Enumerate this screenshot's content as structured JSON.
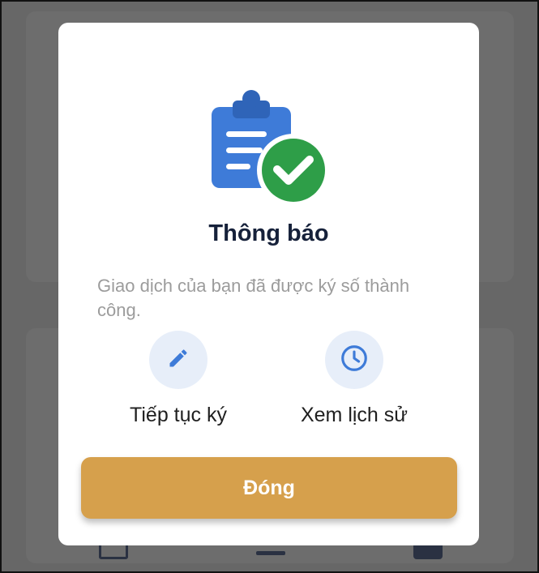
{
  "dialog": {
    "icon": "clipboard-check-icon",
    "title": "Thông báo",
    "message": "Giao dịch của bạn đã được ký số thành công.",
    "actions": [
      {
        "icon": "pencil-icon",
        "label": "Tiếp tục ký"
      },
      {
        "icon": "clock-icon",
        "label": "Xem lịch sử"
      }
    ],
    "close_label": "Đóng"
  },
  "colors": {
    "overlay": "#676767",
    "dialog_bg": "#ffffff",
    "title": "#16213a",
    "message": "#9c9c9c",
    "action_circle": "#e7eef9",
    "action_icon": "#3e7bd8",
    "clipboard_blue": "#3e7bd8",
    "check_green": "#2e9e48",
    "button": "#d6a04c"
  }
}
